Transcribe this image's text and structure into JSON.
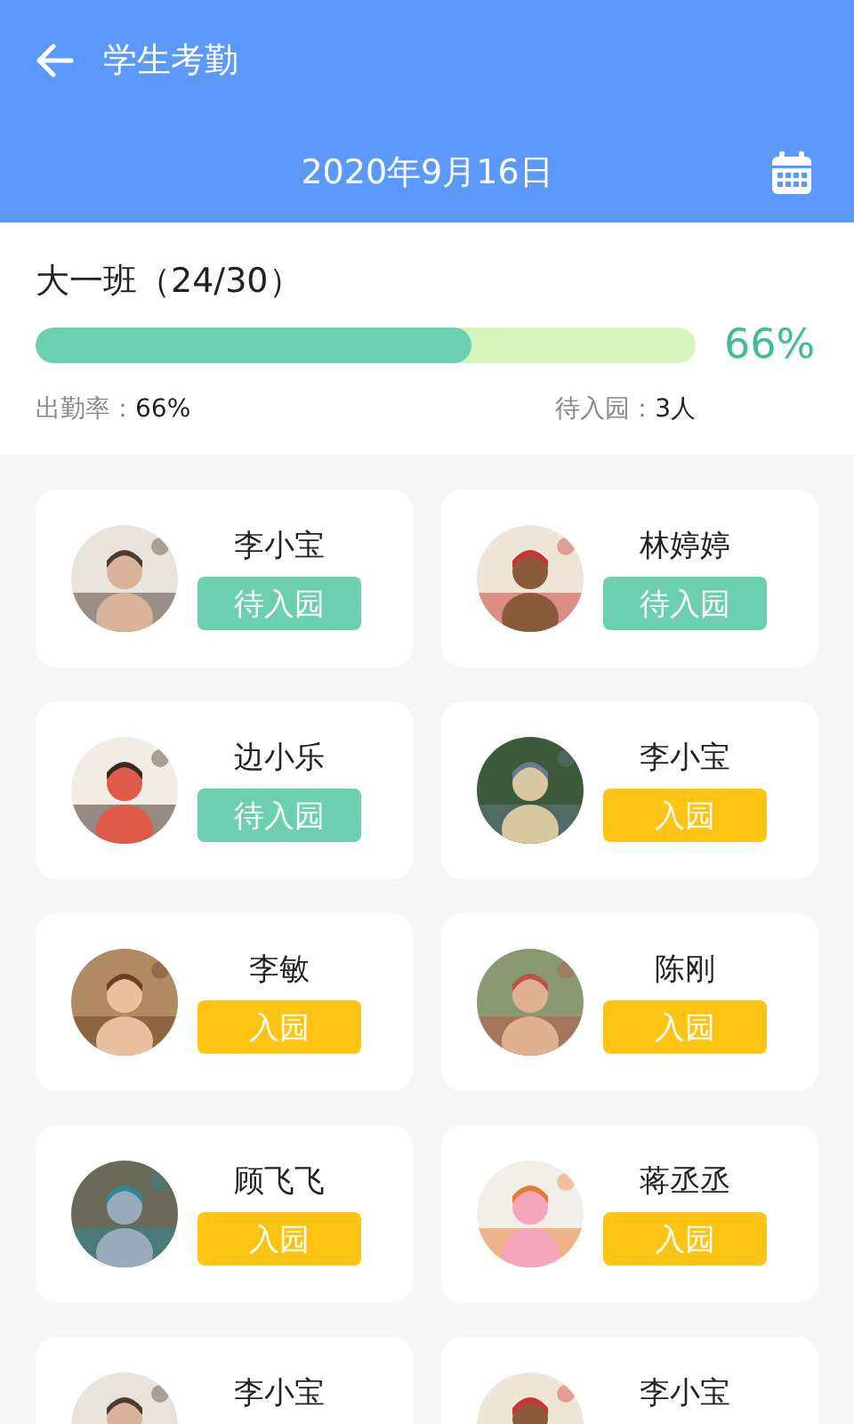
{
  "header": {
    "title": "学生考勤",
    "date": "2020年9月16日"
  },
  "summary": {
    "class_name": "大一班（24/30）",
    "level": 0.66,
    "percent": "66%",
    "rate_label": "出勤率：",
    "rate_value": "66%",
    "pending_label": "待入园：",
    "pending_value": "3人"
  },
  "students": [
    {
      "name": "李小宝",
      "status": {
        "kind": "waiting",
        "label": "待入园"
      }
    },
    {
      "name": "林婷婷",
      "status": {
        "kind": "waiting",
        "label": "待入园"
      }
    },
    {
      "name": "边小乐",
      "status": {
        "kind": "waiting",
        "label": "待入园"
      }
    },
    {
      "name": "李小宝",
      "status": {
        "kind": "entered",
        "label": "入园"
      }
    },
    {
      "name": "李敏",
      "status": {
        "kind": "entered",
        "label": "入园"
      }
    },
    {
      "name": "陈刚",
      "status": {
        "kind": "entered",
        "label": "入园"
      }
    },
    {
      "name": "顾飞飞",
      "status": {
        "kind": "entered",
        "label": "入园"
      }
    },
    {
      "name": "蒋丞丞",
      "status": {
        "kind": "entered",
        "label": "入园"
      }
    },
    {
      "name": "李小宝"
    },
    {
      "name": "李小宝"
    }
  ]
}
